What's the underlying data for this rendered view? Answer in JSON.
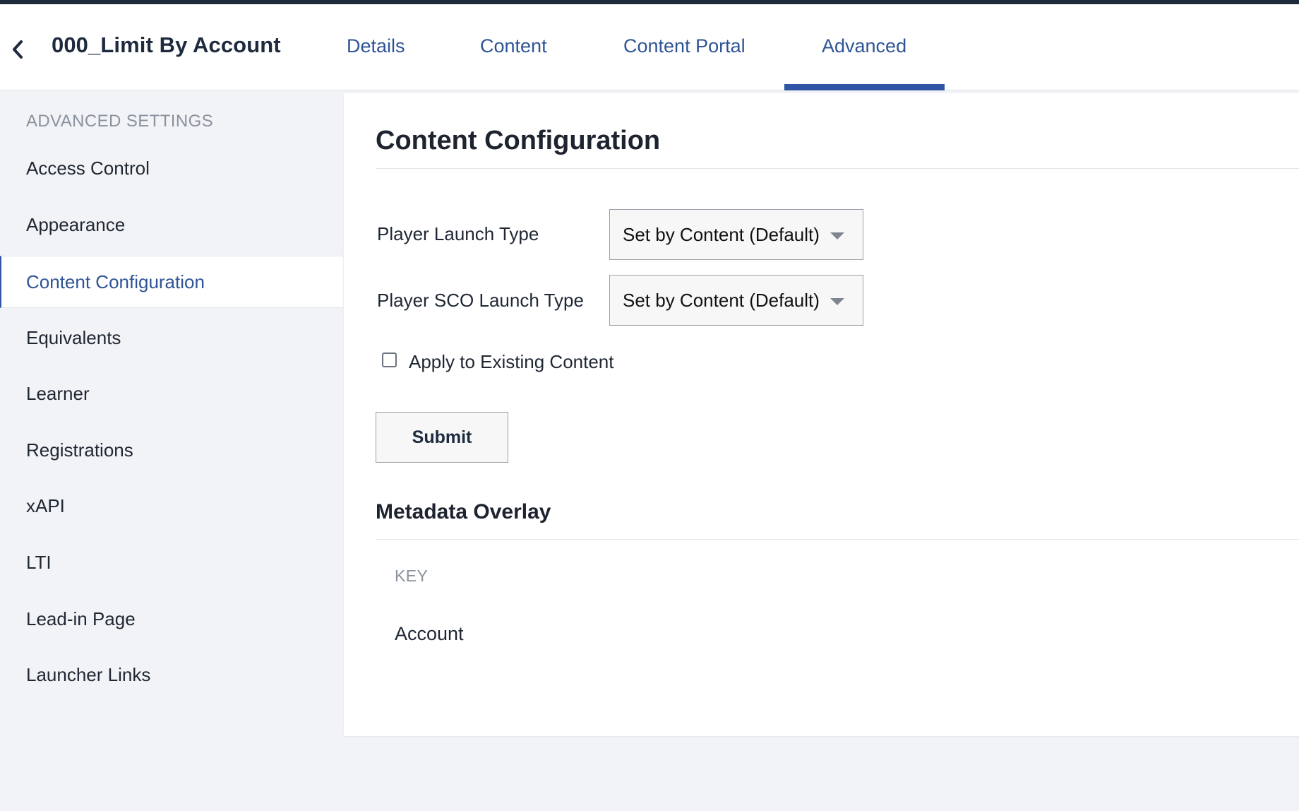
{
  "header": {
    "back_icon": "chevron-left-icon",
    "title": "000_Limit By Account",
    "tabs": [
      {
        "label": "Details",
        "active": false
      },
      {
        "label": "Content",
        "active": false
      },
      {
        "label": "Content Portal",
        "active": false
      },
      {
        "label": "Advanced",
        "active": true
      }
    ],
    "accent_color": "#2f55a4"
  },
  "sidebar": {
    "heading": "ADVANCED SETTINGS",
    "items": [
      {
        "label": "Access Control",
        "active": false
      },
      {
        "label": "Appearance",
        "active": false
      },
      {
        "label": "Content Configuration",
        "active": true
      },
      {
        "label": "Equivalents",
        "active": false
      },
      {
        "label": "Learner",
        "active": false
      },
      {
        "label": "Registrations",
        "active": false
      },
      {
        "label": "xAPI",
        "active": false
      },
      {
        "label": "LTI",
        "active": false
      },
      {
        "label": "Lead-in Page",
        "active": false
      },
      {
        "label": "Launcher Links",
        "active": false
      }
    ]
  },
  "main": {
    "title": "Content Configuration",
    "fields": [
      {
        "label": "Player Launch Type",
        "value": "Set by Content (Default)"
      },
      {
        "label": "Player SCO Launch Type",
        "value": "Set by Content (Default)"
      }
    ],
    "apply_checkbox": {
      "label": "Apply to Existing Content",
      "checked": false
    },
    "submit_label": "Submit",
    "metadata": {
      "title": "Metadata Overlay",
      "column_header": "KEY",
      "rows": [
        "Account"
      ]
    }
  }
}
